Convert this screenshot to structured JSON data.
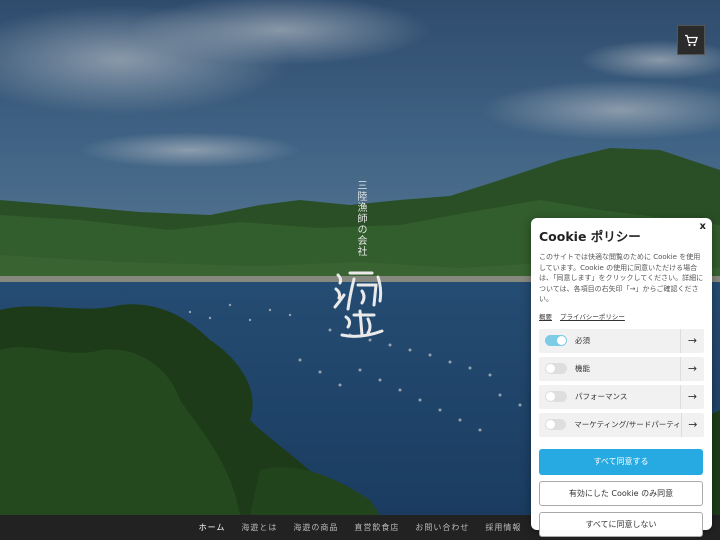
{
  "logo": {
    "subtitle": "三陸漁師の会社",
    "name": "海遊"
  },
  "header": {
    "cart_icon": "cart-icon"
  },
  "nav": {
    "items": [
      {
        "label": "ホーム",
        "active": true
      },
      {
        "label": "海遊とは",
        "active": false
      },
      {
        "label": "海遊の商品",
        "active": false
      },
      {
        "label": "直営飲食店",
        "active": false
      },
      {
        "label": "お問い合わせ",
        "active": false
      },
      {
        "label": "採用情報",
        "active": false
      }
    ]
  },
  "cookie": {
    "title": "Cookie ポリシー",
    "close_label": "x",
    "description": "このサイトでは快適な閲覧のために Cookie を使用しています。Cookie の使用に同意いただける場合は、「同意します」をクリックしてください。詳細については、各項目の右矢印「→」からご確認ください。",
    "link_overview": "概要",
    "link_privacy": "プライバシーポリシー",
    "categories": [
      {
        "label": "必須",
        "enabled": true
      },
      {
        "label": "機能",
        "enabled": false
      },
      {
        "label": "パフォーマンス",
        "enabled": false
      },
      {
        "label": "マーケティング/サードパーティ",
        "enabled": false
      }
    ],
    "arrow": "→",
    "accept_all": "すべて同意する",
    "accept_selected": "有効にした Cookie のみ同意",
    "reject_all": "すべてに同意しない"
  },
  "colors": {
    "accent": "#27a9e1",
    "toggle_on": "#7ecbe6",
    "nav_bg": "#222222"
  }
}
